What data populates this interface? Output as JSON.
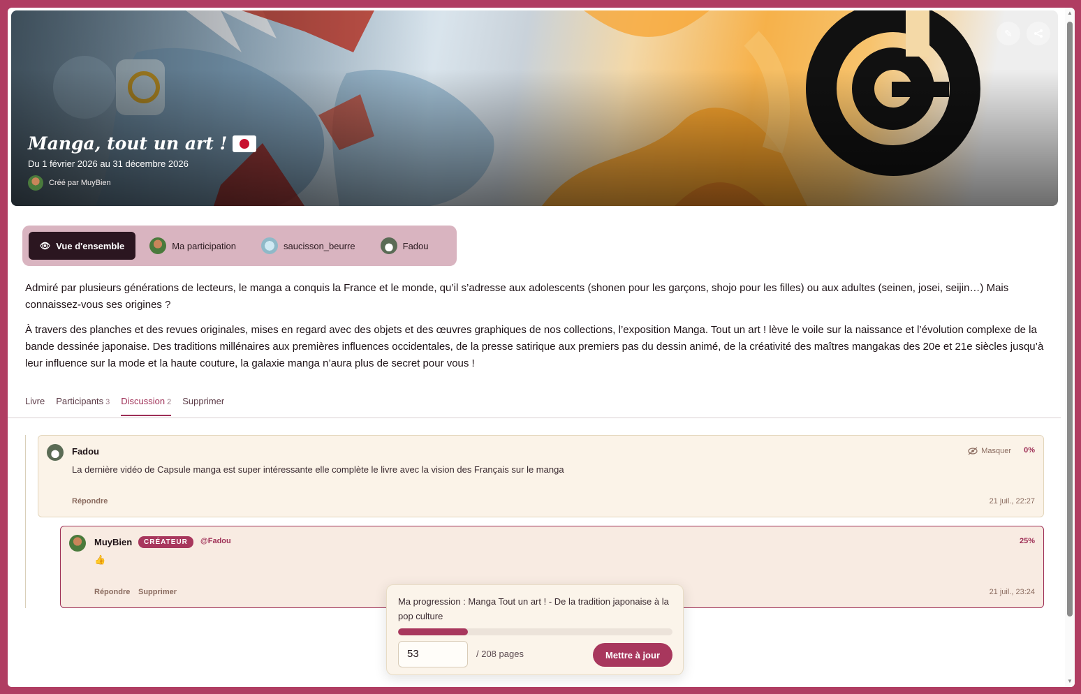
{
  "colors": {
    "accent": "#a8375d",
    "page_bg": "#b03d62",
    "tab_active_bg": "#2b1620"
  },
  "banner": {
    "title": "Manga, tout un art !",
    "dates": "Du 1 février 2026 au 31 décembre 2026",
    "creator": "Créé par MuyBien",
    "edit_icon": "pencil-icon",
    "share_icon": "share-icon"
  },
  "participant_tabs": [
    {
      "label": "Vue d'ensemble",
      "icon": "eye-icon",
      "active": true
    },
    {
      "label": "Ma participation",
      "icon": "avatar-muybien"
    },
    {
      "label": "saucisson_beurre",
      "icon": "avatar-saucisson"
    },
    {
      "label": "Fadou",
      "icon": "avatar-fadou"
    }
  ],
  "description": {
    "p1": "Admiré par plusieurs générations de lecteurs, le manga a conquis la France et le monde, qu’il s’adresse aux adolescents (shonen pour les garçons, shojo pour les filles) ou aux adultes (seinen, josei, seijin…) Mais connaissez-vous ses origines ?",
    "p2": "À travers des planches et des revues originales, mises en regard avec des objets et des œuvres graphiques de nos collections, l’exposition Manga. Tout un art ! lève le voile sur la naissance et l’évolution complexe de la bande dessinée japonaise. Des traditions millénaires aux premières influences occidentales, de la presse satirique aux premiers pas du dessin animé, de la créativité des maîtres mangakas des 20e et 21e siècles jusqu’à leur influence sur la mode et la haute couture, la galaxie manga n’aura plus de secret pour vous !"
  },
  "tabs": [
    {
      "label": "Livre",
      "count": ""
    },
    {
      "label": "Participants",
      "count": "3"
    },
    {
      "label": "Discussion",
      "count": "2",
      "active": true
    },
    {
      "label": "Supprimer",
      "count": ""
    }
  ],
  "comments": [
    {
      "author": "Fadou",
      "text": "La dernière vidéo de Capsule manga est super intéressante elle complète le livre avec la vision des Français sur le manga",
      "hide_label": "Masquer",
      "progress": "0%",
      "reply_label": "Répondre",
      "time": "21 juil., 22:27"
    },
    {
      "author": "MuyBien",
      "badge": "CRÉATEUR",
      "mention": "@Fadou",
      "text": "👍",
      "progress": "25%",
      "reply_label": "Répondre",
      "delete_label": "Supprimer",
      "time": "21 juil., 23:24"
    }
  ],
  "progress_popup": {
    "title": "Ma progression : Manga Tout un art ! - De la tradition japonaise à la pop culture",
    "current_page": "53",
    "total": "/ 208 pages",
    "fraction": 0.255,
    "button": "Mettre à jour"
  }
}
